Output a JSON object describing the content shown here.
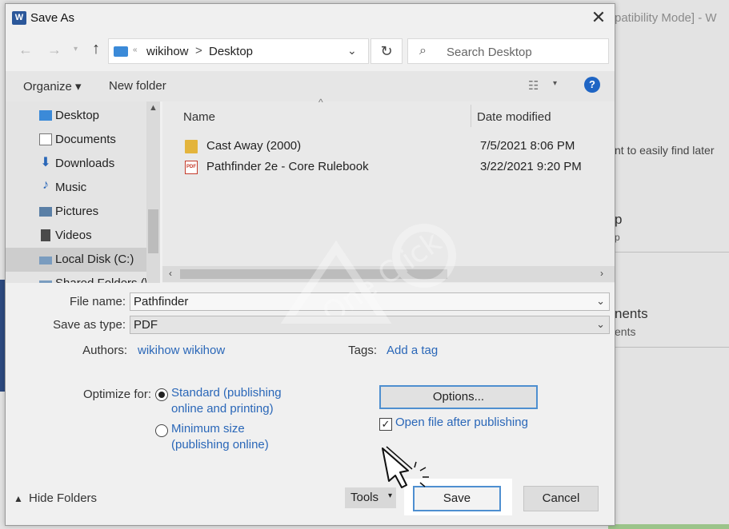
{
  "background": {
    "title_fragment": "patibility Mode]  -  W",
    "text1": "nt to easily find later",
    "text2": "p",
    "text2b": "p",
    "text3": "nents",
    "text3b": "ents"
  },
  "dialog": {
    "title": "Save As",
    "close_glyph": "✕",
    "app_icon_letter": "W"
  },
  "address": {
    "crumbs": [
      "wikihow",
      "Desktop"
    ],
    "separator": ">",
    "overflow": "«"
  },
  "search": {
    "placeholder": "Search Desktop"
  },
  "toolbar": {
    "organize": "Organize ▾",
    "new_folder": "New folder",
    "help": "?"
  },
  "nav_pane": {
    "items": [
      {
        "label": "Desktop",
        "icon": "desktop-icon"
      },
      {
        "label": "Documents",
        "icon": "documents-icon"
      },
      {
        "label": "Downloads",
        "icon": "downloads-icon"
      },
      {
        "label": "Music",
        "icon": "music-icon"
      },
      {
        "label": "Pictures",
        "icon": "pictures-icon"
      },
      {
        "label": "Videos",
        "icon": "videos-icon"
      },
      {
        "label": "Local Disk (C:)",
        "icon": "drive-icon",
        "selected": true
      },
      {
        "label": "Shared Folders (\\",
        "icon": "network-drive-icon"
      }
    ]
  },
  "file_list": {
    "columns": [
      "Name",
      "Date modified"
    ],
    "rows": [
      {
        "name": "Cast Away (2000)",
        "date": "7/5/2021 8:06 PM",
        "type": "folder"
      },
      {
        "name": "Pathfinder 2e - Core Rulebook",
        "date": "3/22/2021 9:20 PM",
        "type": "pdf"
      }
    ]
  },
  "form": {
    "file_name_label": "File name:",
    "file_name_value": "Pathfinder",
    "save_type_label": "Save as type:",
    "save_type_value": "PDF",
    "authors_label": "Authors:",
    "authors_value": "wikihow wikihow",
    "tags_label": "Tags:",
    "tags_value": "Add a tag",
    "optimize_label": "Optimize for:",
    "optimize_standard_line1": "Standard (publishing",
    "optimize_standard_line2": "online and printing)",
    "optimize_minimum_line1": "Minimum size",
    "optimize_minimum_line2": "(publishing online)",
    "optimize_selected": "standard",
    "options_button": "Options...",
    "open_after_publishing": "Open file after publishing",
    "open_after_publishing_checked": true
  },
  "footer": {
    "hide_folders": "Hide Folders",
    "tools": "Tools",
    "save": "Save",
    "cancel": "Cancel"
  },
  "colors": {
    "accent": "#4e8fd0",
    "link": "#2a67b8",
    "help": "#1f65c4"
  }
}
